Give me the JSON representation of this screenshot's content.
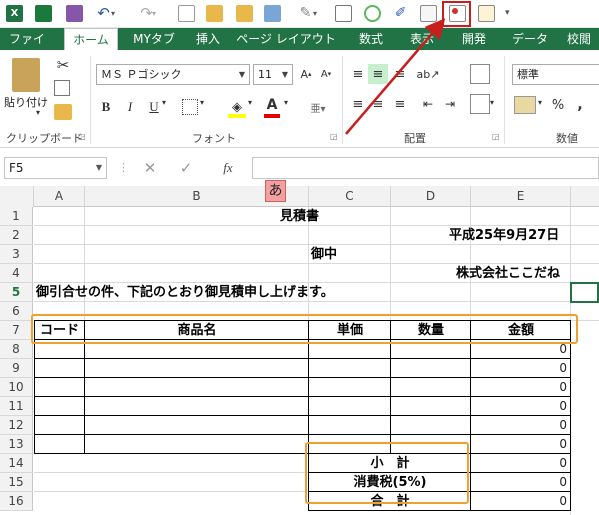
{
  "ribbon_tabs": [
    "ファイル",
    "ホーム",
    "MYタブ",
    "挿入",
    "ページ レイアウト",
    "数式",
    "表示",
    "開発",
    "データ",
    "校閲"
  ],
  "active_tab": "ホーム",
  "clipboard": {
    "paste_label": "貼り付け",
    "group_label": "クリップボード"
  },
  "font": {
    "name": "ＭＳ Ｐゴシック",
    "size": "11",
    "bold": "B",
    "italic": "I",
    "underline": "U",
    "group_label": "フォント",
    "font_color_letter": "A"
  },
  "alignment": {
    "group_label": "配置"
  },
  "number": {
    "format": "標準",
    "group_label": "数値",
    "percent": "%",
    "comma": ","
  },
  "formula_bar": {
    "name_box": "F5",
    "fx": "fx",
    "formula": ""
  },
  "ime_indicator": "あ",
  "columns": [
    "A",
    "B",
    "C",
    "D",
    "E"
  ],
  "rows": [
    "1",
    "2",
    "3",
    "4",
    "5",
    "6",
    "7",
    "8",
    "9",
    "10",
    "11",
    "12",
    "13",
    "14",
    "15",
    "16"
  ],
  "sheet": {
    "title": "見積書",
    "date": "平成25年9月27日",
    "recipient": "御中",
    "company": "株式会社ここだね",
    "intro": "御引合せの件、下記のとおり御見積申し上げます。",
    "headers": [
      "コード",
      "商品名",
      "単価",
      "数量",
      "金額"
    ],
    "zeros": [
      "0",
      "0",
      "0",
      "0",
      "0",
      "0",
      "0",
      "0",
      "0"
    ],
    "subtotal": "小　計",
    "tax": "消費税(5%)",
    "total": "合　計"
  },
  "colors": {
    "excel_green": "#217346",
    "highlight_orange": "#f0a030",
    "annotation_red": "#c81e1e",
    "ime_bg": "#f4a0a0"
  }
}
